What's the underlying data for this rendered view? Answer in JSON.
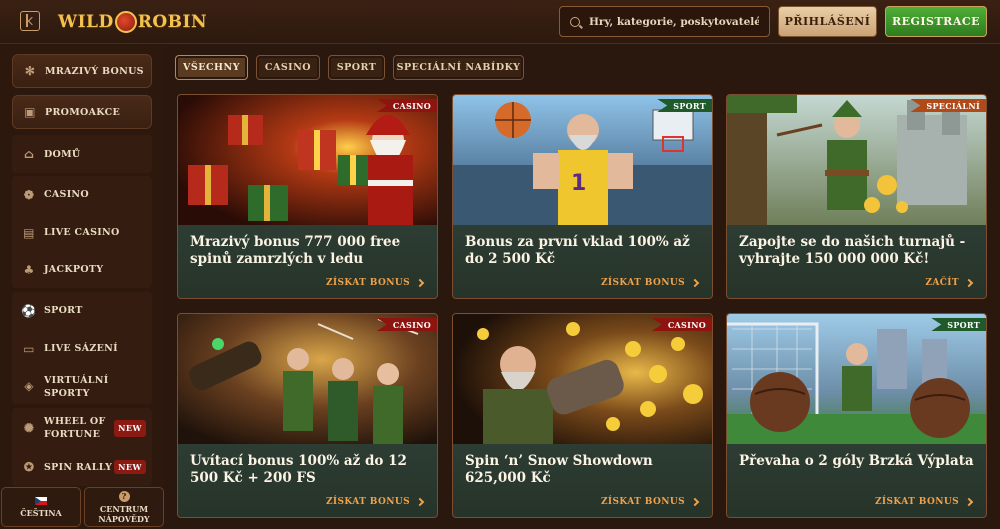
{
  "header": {
    "logo_text_left": "WILD",
    "logo_text_right": "ROBIN",
    "search_placeholder": "Hry, kategorie, poskytovatelé",
    "login_label": "PŘIHLÁŠENÍ",
    "register_label": "REGISTRACE"
  },
  "sidebar": {
    "items": [
      {
        "label": "MRAZIVÝ BONUS",
        "icon": "snowflake-icon"
      },
      {
        "label": "PROMOAKCE",
        "icon": "gift-icon"
      },
      {
        "label": "DOMŮ",
        "icon": "home-icon"
      },
      {
        "label": "CASINO",
        "icon": "slot-icon"
      },
      {
        "label": "LIVE CASINO",
        "icon": "cards-icon"
      },
      {
        "label": "JACKPOTY",
        "icon": "clover-icon"
      },
      {
        "label": "SPORT",
        "icon": "ball-icon"
      },
      {
        "label": "LIVE SÁZENÍ",
        "icon": "live-icon"
      },
      {
        "label": "VIRTUÁLNÍ SPORTY",
        "icon": "virtual-icon"
      },
      {
        "label": "WHEEL OF FORTUNE",
        "icon": "wheel-icon",
        "badge": "NEW"
      },
      {
        "label": "SPIN RALLY",
        "icon": "rally-icon",
        "badge": "NEW"
      }
    ],
    "language_label": "ČEŠTINA",
    "help_label_1": "CENTRUM",
    "help_label_2": "NÁPOVĚDY"
  },
  "filters": [
    "VŠECHNY",
    "CASINO",
    "SPORT",
    "SPECIÁLNÍ NABÍDKY"
  ],
  "cards": [
    {
      "tag": "CASINO",
      "title": "Mrazivý bonus 777 000 free spinů zamrzlých v ledu",
      "cta": "ZÍSKAT BONUS"
    },
    {
      "tag": "SPORT",
      "title": "Bonus za první vklad 100% až do 2 500 Kč",
      "cta": "ZÍSKAT BONUS"
    },
    {
      "tag": "SPECIÁLNÍ",
      "title": "Zapojte se do našich turnajů - vyhrajte 150 000 000 Kč!",
      "cta": "ZAČÍT"
    },
    {
      "tag": "CASINO",
      "title": "Uvítací bonus 100% až do 12 500 Kč + 200 FS",
      "cta": "ZÍSKAT BONUS"
    },
    {
      "tag": "CASINO",
      "title": "Spin ‘n’ Snow Showdown 625,000 Kč",
      "cta": "ZÍSKAT BONUS"
    },
    {
      "tag": "SPORT",
      "title": "Převaha o 2 góly Brzká Výplata",
      "cta": "ZÍSKAT BONUS"
    }
  ]
}
